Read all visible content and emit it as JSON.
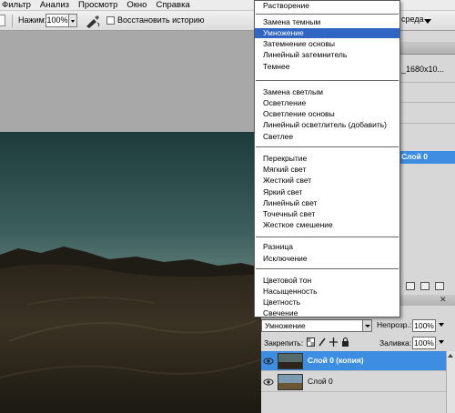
{
  "menubar": {
    "items": [
      "Фильтр",
      "Анализ",
      "Просмотр",
      "Окно",
      "Справка"
    ]
  },
  "options_bar": {
    "pressure_label": "Нажим:",
    "pressure_value": "100%",
    "restore_history_label": "Восстановить историю",
    "workspace_label": "среда"
  },
  "panel": {
    "dimensions_text": "_1680x10...",
    "selected_layer_strip": "Слой 0"
  },
  "blend_menu": {
    "selected": "Умножение",
    "groups": [
      [
        "Растворение"
      ],
      [
        "Замена темным",
        "Умножение",
        "Затемнение основы",
        "Линейный затемнитель",
        "Темнее"
      ],
      [
        "Замена светлым",
        "Осветление",
        "Осветление основы",
        "Линейный осветлитель (добавить)",
        "Светлее"
      ],
      [
        "Перекрытие",
        "Мягкий свет",
        "Жесткий свет",
        "Яркий свет",
        "Линейный свет",
        "Точечный свет",
        "Жесткое смешение"
      ],
      [
        "Разница",
        "Исключение"
      ],
      [
        "Цветовой тон",
        "Насыщенность",
        "Цветность",
        "Свечение"
      ]
    ]
  },
  "layers": {
    "blend_mode": "Умножение",
    "opacity_label": "Непрозр.:",
    "opacity_value": "100%",
    "lock_label": "Закрепить:",
    "fill_label": "Заливка:",
    "fill_value": "100%",
    "items": [
      {
        "name": "Слой 0 (копия)",
        "selected": true
      },
      {
        "name": "Слой 0",
        "selected": false
      }
    ]
  },
  "colors": {
    "menu_highlight": "#3165c4",
    "layer_selected": "#3d8ee3",
    "panel_bg": "#d7d7d7"
  }
}
